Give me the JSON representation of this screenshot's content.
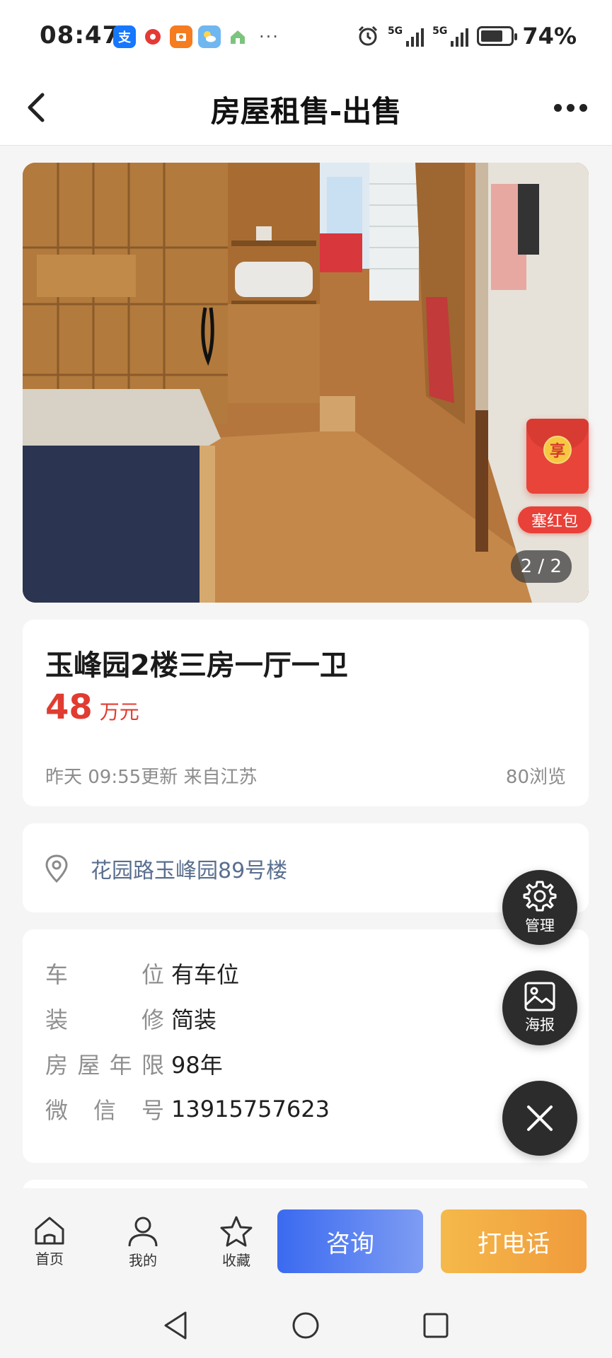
{
  "status_bar": {
    "time": "08:47",
    "battery": "74%",
    "battery_level": 0.74,
    "network_1": "5G",
    "network_2": "5G",
    "apps": [
      "alipay-icon",
      "red-record-icon",
      "orange-app-icon",
      "weather-icon",
      "home-app-icon"
    ],
    "more": "···"
  },
  "header": {
    "title": "房屋租售-出售"
  },
  "photo": {
    "counter": "2 / 2"
  },
  "red_packet": {
    "coin_text": "享",
    "label": "塞红包"
  },
  "listing": {
    "title": "玉峰园2楼三房一厅一卫",
    "price": "48",
    "price_unit": "万元",
    "updated": "昨天 09:55更新 来自江苏",
    "views": "80浏览"
  },
  "address": "花园路玉峰园89号楼",
  "details": [
    {
      "label": "车位",
      "value": "有车位"
    },
    {
      "label": "装修",
      "value": "简装"
    },
    {
      "label": "房屋年限",
      "value": "98年"
    },
    {
      "label": "微信号",
      "value": "13915757623"
    }
  ],
  "fabs": {
    "manage": "管理",
    "poster": "海报"
  },
  "bottom_nav": {
    "home": "首页",
    "mine": "我的",
    "favorite": "收藏",
    "consult": "咨询",
    "call": "打电话"
  },
  "colors": {
    "price": "#e03c31",
    "address": "#5a6f8f",
    "consult_start": "#3a6af0",
    "call_start": "#f5b94a"
  }
}
